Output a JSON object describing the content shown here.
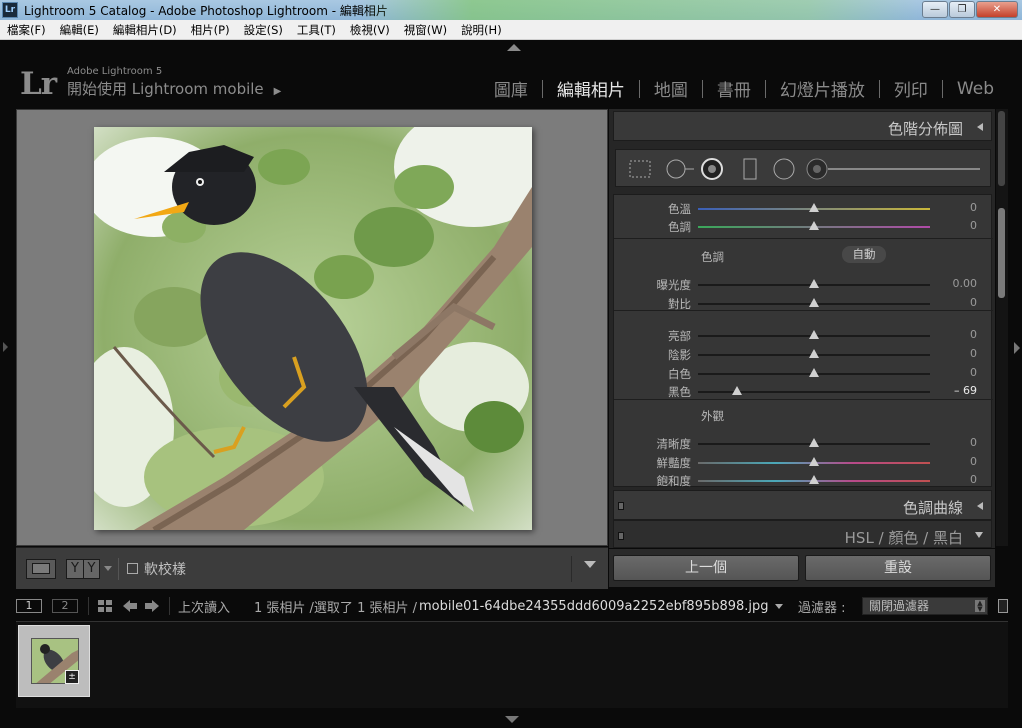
{
  "window": {
    "title": "Lightroom 5 Catalog - Adobe Photoshop Lightroom - 編輯相片",
    "app_icon": "Lr",
    "buttons": {
      "minimize": "—",
      "maximize": "❐",
      "close": "✕"
    }
  },
  "menubar": [
    "檔案(F)",
    "編輯(E)",
    "編輯相片(D)",
    "相片(P)",
    "設定(S)",
    "工具(T)",
    "檢視(V)",
    "視窗(W)",
    "說明(H)"
  ],
  "identity": {
    "logo": "Lr",
    "product": "Adobe Lightroom 5",
    "mobile": "開始使用 Lightroom mobile"
  },
  "modules": [
    {
      "label": "圖庫",
      "active": false
    },
    {
      "label": "編輯相片",
      "active": true
    },
    {
      "label": "地圖",
      "active": false
    },
    {
      "label": "書冊",
      "active": false
    },
    {
      "label": "幻燈片播放",
      "active": false
    },
    {
      "label": "列印",
      "active": false
    },
    {
      "label": "Web",
      "active": false
    }
  ],
  "panel": {
    "histogram_title": "色階分佈圖",
    "groups": {
      "tone": "色調",
      "presence": "外觀",
      "auto": "自動"
    },
    "sliders": [
      {
        "label": "色溫",
        "value": "0",
        "pos": 0.5,
        "track": "temp"
      },
      {
        "label": "色調",
        "value": "0",
        "pos": 0.5,
        "track": "tint"
      },
      {
        "label": "曝光度",
        "value": "0.00",
        "pos": 0.5
      },
      {
        "label": "對比",
        "value": "0",
        "pos": 0.5
      },
      {
        "label": "亮部",
        "value": "0",
        "pos": 0.5
      },
      {
        "label": "陰影",
        "value": "0",
        "pos": 0.5
      },
      {
        "label": "白色",
        "value": "0",
        "pos": 0.5
      },
      {
        "label": "黑色",
        "value": "– 69",
        "pos": 0.17,
        "highlight": true
      },
      {
        "label": "清晰度",
        "value": "0",
        "pos": 0.5
      },
      {
        "label": "鮮豔度",
        "value": "0",
        "pos": 0.5,
        "track": "sat"
      },
      {
        "label": "飽和度",
        "value": "0",
        "pos": 0.5,
        "track": "sat"
      }
    ],
    "tone_curve_title": "色調曲線",
    "hsl_title": "HSL  /  顏色  /  黑白",
    "prev_button": "上一個",
    "reset_button": "重設"
  },
  "toolbar": {
    "softproof": "軟校樣",
    "yy": [
      "Y",
      "Y"
    ]
  },
  "filmstrip": {
    "pages": [
      "1",
      "2"
    ],
    "source": "上次讀入",
    "count": "1 張相片 /選取了 1 張相片 /",
    "filename": "mobile01-64dbe24355ddd6009a2252ebf895b898.jpg",
    "filter_label": "過濾器 :",
    "filter_value": "關閉過濾器"
  },
  "colors": {
    "accent_active": "#e6e6e6",
    "panel_bg": "#363636",
    "image_bg": "#7c7c7c"
  }
}
